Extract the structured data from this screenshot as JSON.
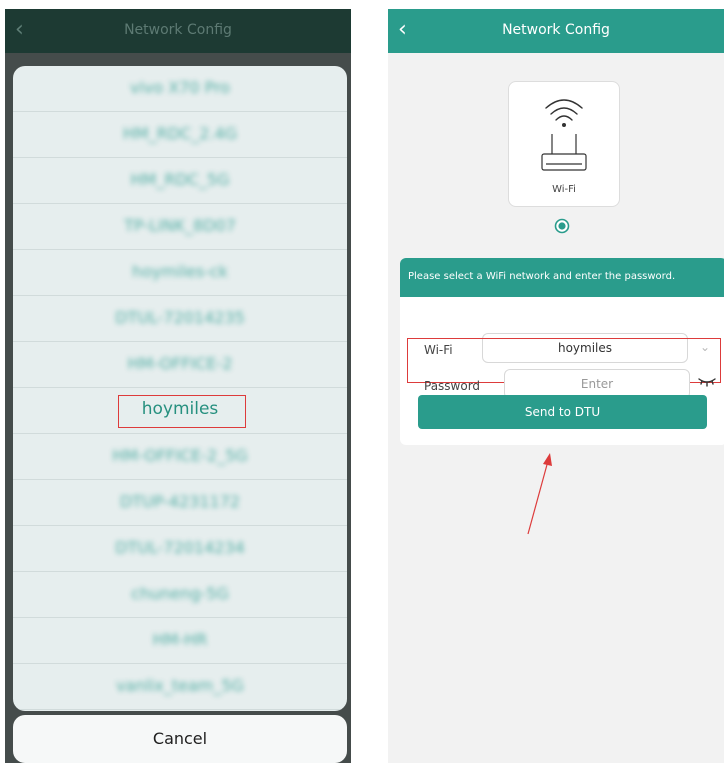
{
  "left_screen": {
    "header": {
      "title": "Network Config",
      "back_icon": "chevron-left-icon"
    },
    "networks": [
      {
        "name": "vivo X70 Pro",
        "selected": false
      },
      {
        "name": "HM_RDC_2.4G",
        "selected": false
      },
      {
        "name": "HM_RDC_5G",
        "selected": false
      },
      {
        "name": "TP-LINK_8D07",
        "selected": false
      },
      {
        "name": "hoymiles-ck",
        "selected": false
      },
      {
        "name": "DTUL-72014235",
        "selected": false
      },
      {
        "name": "HM-OFFICE-2",
        "selected": false
      },
      {
        "name": "hoymiles",
        "selected": true
      },
      {
        "name": "HM-OFFICE-2_5G",
        "selected": false
      },
      {
        "name": "DTUP-4231172",
        "selected": false
      },
      {
        "name": "DTUL-72014234",
        "selected": false
      },
      {
        "name": "chuneng-5G",
        "selected": false
      },
      {
        "name": "HM-HR",
        "selected": false
      },
      {
        "name": "vanlix_team_5G",
        "selected": false
      }
    ],
    "cancel_label": "Cancel"
  },
  "right_screen": {
    "header": {
      "title": "Network Config",
      "back_icon": "chevron-left-icon"
    },
    "wifi_card": {
      "label": "Wi-Fi",
      "icon": "router-wifi-icon",
      "selected": true
    },
    "instruction": "Please select a WiFi network and enter the password.",
    "form": {
      "wifi_label": "Wi-Fi",
      "wifi_value": "hoymiles",
      "password_label": "Password",
      "password_placeholder": "Enter",
      "eye_icon": "eye-closed-icon",
      "dropdown_icon": "chevron-down-icon"
    },
    "send_button": "Send to DTU"
  },
  "colors": {
    "accent": "#2a9c8c",
    "highlight": "#dd3b3b"
  }
}
